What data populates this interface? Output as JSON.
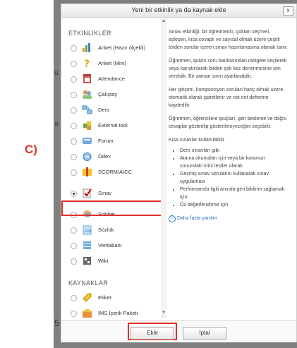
{
  "side_label": "C)",
  "background_fragments": [
    "u",
    "a",
    "5"
  ],
  "dialog": {
    "title": "Yeni bir etkinlik ya da kaynak ekle",
    "close_label": "x",
    "activities_header": "ETKİNLİKLER",
    "resources_header": "KAYNAKLAR",
    "activities": [
      {
        "label": "Anket (Hazır ölçekli)",
        "icon": "survey-chart-icon",
        "selected": false
      },
      {
        "label": "Anket (Mini)",
        "icon": "question-mark-icon",
        "selected": false
      },
      {
        "label": "Attendance",
        "icon": "attendance-icon",
        "selected": false
      },
      {
        "label": "Çalıştay",
        "icon": "workshop-icon",
        "selected": false
      },
      {
        "label": "Ders",
        "icon": "lesson-icon",
        "selected": false
      },
      {
        "label": "External tool",
        "icon": "puzzle-icon",
        "selected": false
      },
      {
        "label": "Forum",
        "icon": "forum-icon",
        "selected": false
      },
      {
        "label": "Ödev",
        "icon": "assignment-icon",
        "selected": false
      },
      {
        "label": "SCORM/AICC",
        "icon": "scorm-package-icon",
        "selected": false
      },
      {
        "label": "Sınav",
        "icon": "quiz-icon",
        "selected": true
      },
      {
        "label": "Sohbet",
        "icon": "chat-icon",
        "selected": false
      },
      {
        "label": "Sözlük",
        "icon": "glossary-icon",
        "selected": false
      },
      {
        "label": "Veritabanı",
        "icon": "database-icon",
        "selected": false
      },
      {
        "label": "Wiki",
        "icon": "wiki-icon",
        "selected": false
      }
    ],
    "resources": [
      {
        "label": "Etiket",
        "icon": "label-tag-icon"
      },
      {
        "label": "IMS İçerik Paketi",
        "icon": "ims-package-icon"
      }
    ],
    "description": {
      "p1": "Sınav etkinliği, bir öğretmenin, çoktan seçmeli, eşleşen, kısa cevaplı ve sayısal olmak üzere çeşitli türden sorular içeren sınav hazırlamasına olanak tanır.",
      "p2": "Öğretmen, quizin soru bankasından rastgele seçilerek veya karıştırılarak birden çok kez denenmesine izin verebilir. Bir zaman sınırı ayarlanabilir.",
      "p3": "Her girişimi, kompozisyon soruları hariç olmak üzere otomatik olarak işaretlenir ve not not defterine kaydedilir.",
      "p4": "Öğretmen, öğrencilere ipuçları, geri besleme ve doğru cevaplar gösterilip gösterilmeyeceğini seçebilir.",
      "p5": "Kısa sınavlar kullanılabilir",
      "bullets": [
        "Ders sınavları gibi",
        "Atama okumaları için veya bir konunun sonundaki mini testler olarak",
        "Geçmiş sınav sorularını kullanarak sınav uygulaması",
        "Performansla ilgili anında geri bildirim sağlamak için",
        "Öz değerlendirme için"
      ],
      "more_help": "Daha fazla yardım"
    },
    "add_button": "Ekle",
    "cancel_button": "İptal"
  },
  "colors": {
    "highlight": "#e0302a",
    "link": "#2a6cbf"
  }
}
